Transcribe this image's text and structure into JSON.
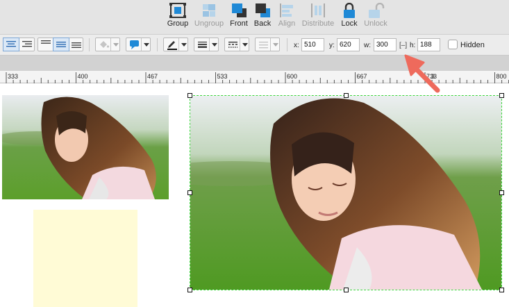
{
  "toolbar": {
    "buttons": [
      {
        "label": "Group",
        "icon": "group-icon",
        "enabled": true
      },
      {
        "label": "Ungroup",
        "icon": "ungroup-icon",
        "enabled": false
      },
      {
        "label": "Front",
        "icon": "bring-to-front-icon",
        "enabled": true
      },
      {
        "label": "Back",
        "icon": "send-to-back-icon",
        "enabled": true
      },
      {
        "label": "Align",
        "icon": "align-icon",
        "enabled": false
      },
      {
        "label": "Distribute",
        "icon": "distribute-icon",
        "enabled": false
      },
      {
        "label": "Lock",
        "icon": "lock-icon",
        "enabled": true
      },
      {
        "label": "Unlock",
        "icon": "unlock-icon",
        "enabled": false
      }
    ]
  },
  "formatbar": {
    "x_label": "x:",
    "x_value": "510",
    "y_label": "y:",
    "y_value": "620",
    "w_label": "w:",
    "w_value": "300",
    "lock_ratio_glyph": "[–]",
    "h_label": "h:",
    "h_value": "188",
    "hidden_label": "Hidden",
    "hidden_checked": false
  },
  "ruler": {
    "labels": [
      "333",
      "400",
      "467",
      "533",
      "600",
      "667",
      "733",
      "800"
    ],
    "partial_label": "3"
  },
  "colors": {
    "accent": "#2f8ad6",
    "selection": "#39d43a",
    "annotation_arrow": "#ee6a5c",
    "sticky_note": "#fffbd6"
  }
}
